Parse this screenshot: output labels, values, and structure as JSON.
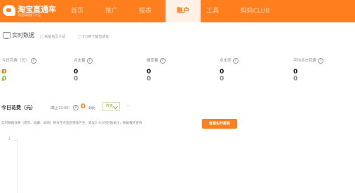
{
  "header": {
    "logo_title": "淘宝直通车",
    "logo_subtitle": "阿里妈妈旗下产品",
    "nav_items": [
      {
        "label": "首页",
        "active": false
      },
      {
        "label": "推广",
        "active": false
      },
      {
        "label": "报表",
        "active": false
      },
      {
        "label": "账户",
        "active": true
      },
      {
        "label": "工具",
        "active": false
      },
      {
        "label": "妈妈CLUB",
        "active": false
      }
    ]
  },
  "realtime": {
    "title": "实时数据",
    "links": [
      "新版首页介绍",
      "5分钟了解直通车"
    ]
  },
  "metrics": [
    {
      "label": "今日花费（元）",
      "value": "0",
      "compare_value": "0"
    },
    {
      "label": "点击量",
      "value": "0",
      "compare_value": "0"
    },
    {
      "label": "展现量",
      "value": "0",
      "compare_value": "0"
    },
    {
      "label": "点击率",
      "value": "0",
      "compare_value": "0"
    },
    {
      "label": "平均点击花费",
      "value": "0",
      "compare_value": "0"
    }
  ],
  "spend": {
    "title": "今日花费（元）",
    "cutoff": "（截止13:00）",
    "value": "0",
    "compare_label": "对比",
    "compare_option": "昨天",
    "extra": "•"
  },
  "notice": {
    "text": "实时数据效果（成交、收藏、加购）将会在点击后持续产生，建议2-3小时后再关注，数据报的查询",
    "button_label": "查看实时报表"
  },
  "chart": {
    "y_ticks": [
      "1"
    ]
  },
  "colors": {
    "brand": "#ff7f1e",
    "accent_red": "#ff6a00",
    "accent_green": "#9ab93b"
  }
}
